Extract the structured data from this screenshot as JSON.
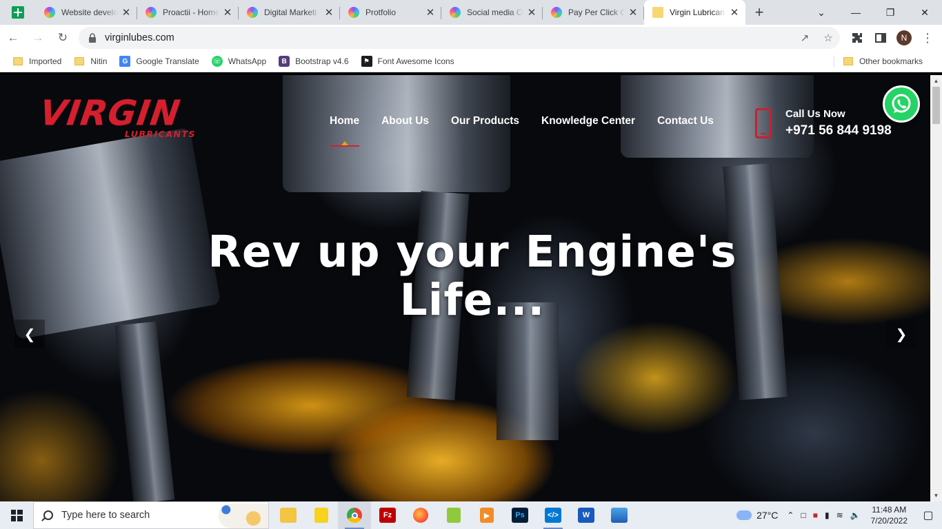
{
  "browser": {
    "tabs": [
      {
        "title": "Website develo",
        "favicon_color": "#7b5cff"
      },
      {
        "title": "Proactii - Home",
        "favicon_color": "#7b5cff"
      },
      {
        "title": "Digital Marketi",
        "favicon_color": "#7b5cff"
      },
      {
        "title": "Protfolio",
        "favicon_color": "#7b5cff"
      },
      {
        "title": "Social media O",
        "favicon_color": "#7b5cff"
      },
      {
        "title": "Pay Per Click Ca",
        "favicon_color": "#7b5cff"
      },
      {
        "title": "Virgin Lubrican",
        "favicon_color": "#f7d774",
        "active": true
      }
    ],
    "url": "virginlubes.com",
    "profile_initial": "N",
    "bookmarks": [
      {
        "label": "Imported",
        "icon": "folder-icon"
      },
      {
        "label": "Nitin",
        "icon": "folder-icon"
      },
      {
        "label": "Google Translate",
        "icon": "google-translate-icon"
      },
      {
        "label": "WhatsApp",
        "icon": "whatsapp-icon"
      },
      {
        "label": "Bootstrap v4.6",
        "icon": "bootstrap-icon"
      },
      {
        "label": "Font Awesome Icons",
        "icon": "font-awesome-icon"
      }
    ],
    "other_bookmarks": "Other bookmarks"
  },
  "site": {
    "logo_main": "VIRGIN",
    "logo_sub": "LUBRICANTS",
    "nav": [
      "Home",
      "About Us",
      "Our Products",
      "Knowledge Center",
      "Contact Us"
    ],
    "active_nav": "Home",
    "call_label": "Call Us Now",
    "call_number": "+971 56 844 9198",
    "hero_line1": "Rev up your Engine's",
    "hero_line2": "Life...",
    "brand_red": "#d51f2f",
    "accent_gold": "#e9a21e"
  },
  "taskbar": {
    "search_placeholder": "Type here to search",
    "temperature": "27°C",
    "time": "11:48 AM",
    "date": "7/20/2022"
  }
}
